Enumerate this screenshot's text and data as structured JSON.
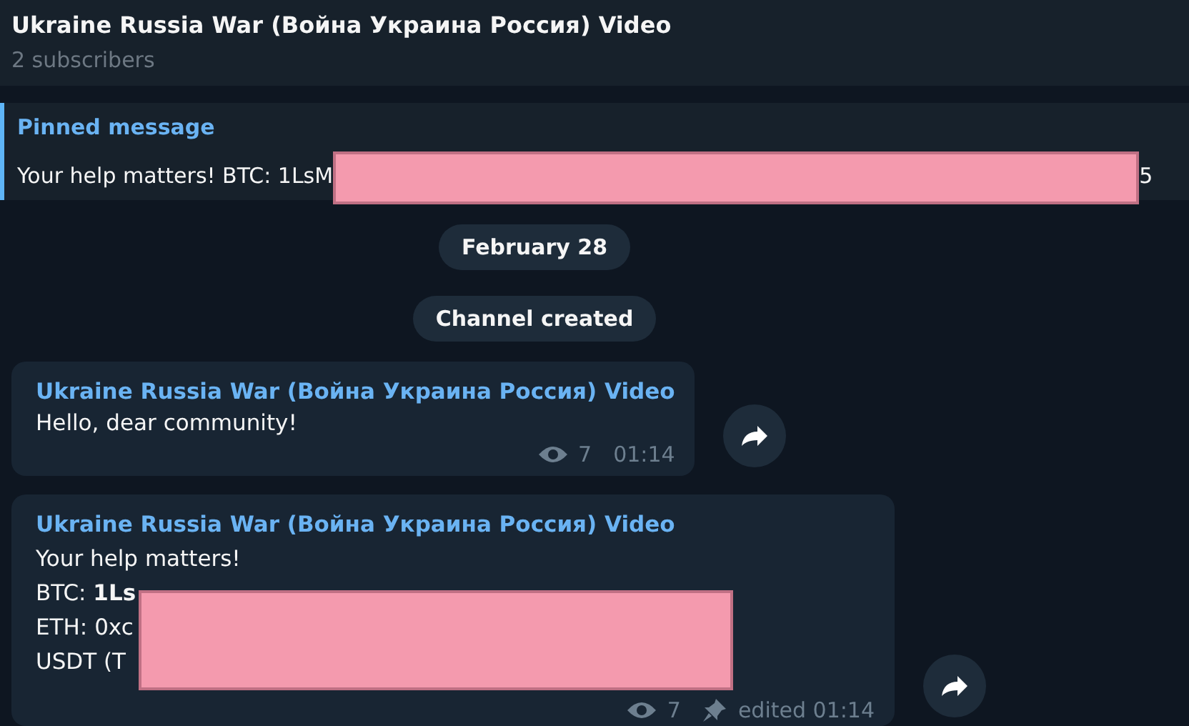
{
  "header": {
    "title": "Ukraine Russia War (Война Украина Россия) Video",
    "subtitle": "2 subscribers"
  },
  "pinned": {
    "label": "Pinned message",
    "text": "Your help matters! BTC: 1LsM",
    "tail": "5"
  },
  "service": [
    "February 28",
    "Channel created"
  ],
  "messages": [
    {
      "author": "Ukraine Russia War (Война Украина Россия) Video",
      "lines": [
        "Hello, dear community!"
      ],
      "views": "7",
      "pinned_mark": false,
      "time": "01:14",
      "redacted": false
    },
    {
      "author": "Ukraine Russia War (Война Украина Россия) Video",
      "lines": [
        "Your help matters!",
        "BTC: **1Ls**",
        "ETH: 0xc",
        "USDT (T"
      ],
      "views": "7",
      "pinned_mark": true,
      "time": "edited 01:14",
      "redacted": true
    }
  ]
}
